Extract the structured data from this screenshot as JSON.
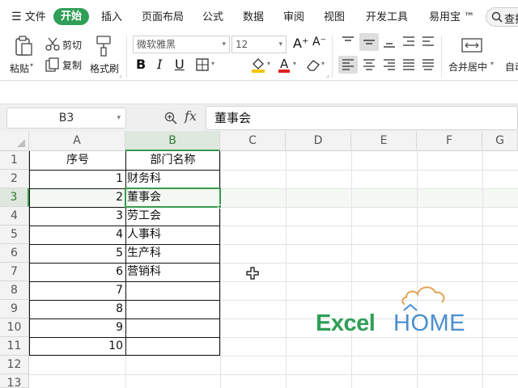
{
  "menu": {
    "hamburger_label": "文件",
    "active_tab": "开始",
    "tabs": [
      "插入",
      "页面布局",
      "公式",
      "数据",
      "审阅",
      "视图",
      "开发工具",
      "易用宝 ™"
    ],
    "search_label": "查找"
  },
  "ribbon": {
    "paste": "粘贴",
    "cut": "剪切",
    "copy": "复制",
    "format_painter": "格式刷",
    "font_name": "微软雅黑",
    "font_size": "12",
    "merge_center": "合并居中",
    "auto_wrap": "自动"
  },
  "formula_bar": {
    "name_box": "B3",
    "fx": "fx",
    "formula": "董事会"
  },
  "grid": {
    "columns": [
      "A",
      "B",
      "C",
      "D",
      "E",
      "F",
      "G"
    ],
    "rows": [
      "1",
      "2",
      "3",
      "4",
      "5",
      "6",
      "7",
      "8",
      "9",
      "10",
      "11",
      "12",
      "13"
    ],
    "header_a": "序号",
    "header_b": "部门名称",
    "serials": [
      "1",
      "2",
      "3",
      "4",
      "5",
      "6",
      "7",
      "8",
      "9",
      "10"
    ],
    "departments": [
      "财务科",
      "董事会",
      "劳工会",
      "人事科",
      "生产科",
      "营销科"
    ],
    "selected_cell": "B3"
  },
  "watermark": {
    "excel": "Excel",
    "home": "HOME"
  },
  "colors": {
    "accent": "#2f9e57",
    "selection": "#3a9a4e",
    "home_blue": "#4a8fcf"
  },
  "icons": [
    "menu-icon",
    "search-icon",
    "paste-icon",
    "cut-icon",
    "copy-icon",
    "format-painter-icon",
    "zoom-icon",
    "cursor-icon",
    "house-icon"
  ]
}
